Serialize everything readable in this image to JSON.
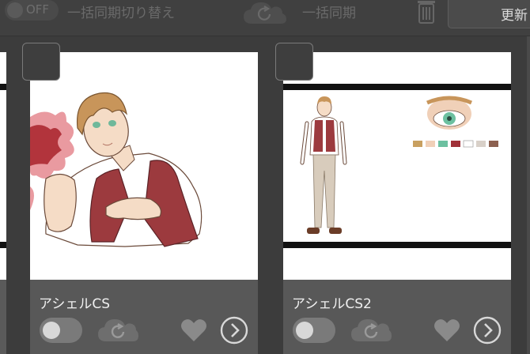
{
  "toolbar": {
    "toggle_text": "OFF",
    "bulk_sync_toggle_label": "一括同期切り替え",
    "bulk_sync_label": "一括同期",
    "update_label": "更新"
  },
  "cards": [
    {
      "name": "アシェルCS"
    },
    {
      "name": "アシェルCS2"
    }
  ],
  "colors": {
    "background": "#3c3c3c",
    "card": "#585858",
    "vest": "#9c3a3e",
    "hair": "#c8955a",
    "eyes": "#6fb89a"
  },
  "palette_swatches": [
    "#c8a060",
    "#f0d0b8",
    "#6cc0a0",
    "#a03038",
    "#ffffff",
    "#d8d0c8",
    "#8c6050"
  ],
  "icons": [
    "cloud-sync-icon",
    "trash-icon",
    "heart-icon",
    "chevron-right-icon"
  ]
}
